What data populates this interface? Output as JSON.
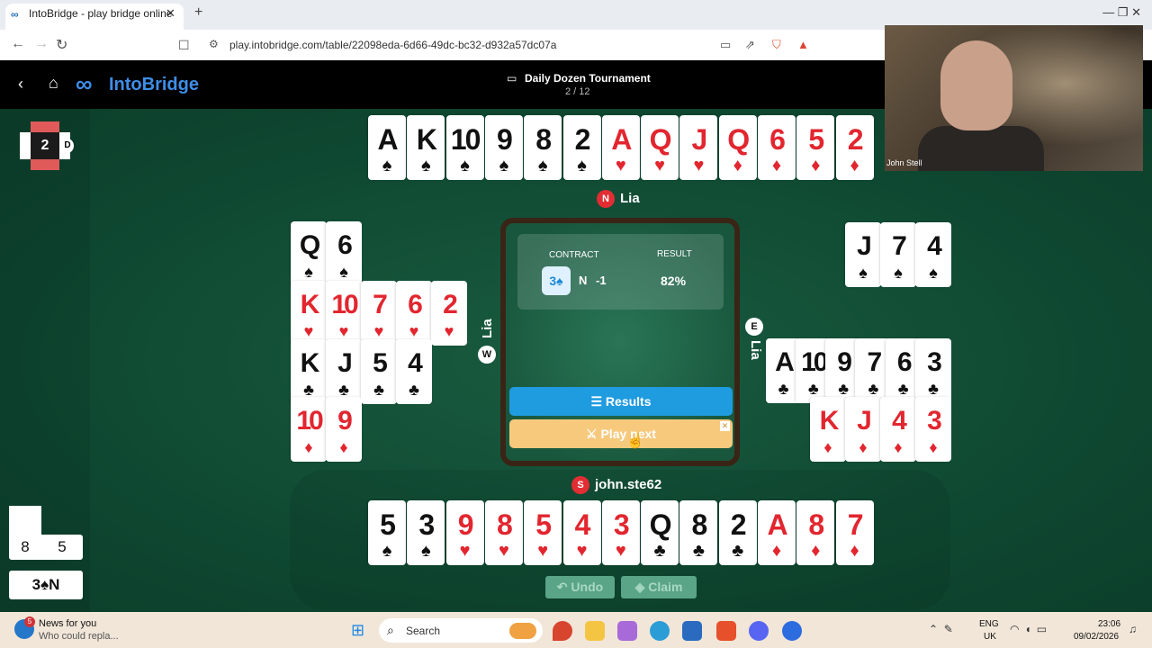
{
  "browser": {
    "tab_title": "IntoBridge - play bridge online",
    "tab_close": "✕",
    "new_tab": "+",
    "url": "play.intobridge.com/table/22098eda-6d66-49dc-bc32-d932a57dc07a",
    "window_controls": "—   ❐   ✕"
  },
  "app": {
    "logo_mark": "∞",
    "logo_text": "IntoBridge",
    "back": "‹",
    "home": "⌂",
    "tournament_title": "Daily Dozen Tournament",
    "tournament_icon": "▭",
    "board_progress": "2 / 12"
  },
  "board": {
    "number": "2",
    "dealer": "D"
  },
  "north": {
    "seat": "N",
    "name": "Lia",
    "cards": [
      {
        "rank": "A",
        "suit": "♠",
        "color": "black"
      },
      {
        "rank": "K",
        "suit": "♠",
        "color": "black"
      },
      {
        "rank": "10",
        "suit": "♠",
        "color": "black"
      },
      {
        "rank": "9",
        "suit": "♠",
        "color": "black"
      },
      {
        "rank": "8",
        "suit": "♠",
        "color": "black"
      },
      {
        "rank": "2",
        "suit": "♠",
        "color": "black"
      },
      {
        "rank": "A",
        "suit": "♥",
        "color": "red"
      },
      {
        "rank": "Q",
        "suit": "♥",
        "color": "red"
      },
      {
        "rank": "J",
        "suit": "♥",
        "color": "red"
      },
      {
        "rank": "Q",
        "suit": "♦",
        "color": "red"
      },
      {
        "rank": "6",
        "suit": "♦",
        "color": "red"
      },
      {
        "rank": "5",
        "suit": "♦",
        "color": "red"
      },
      {
        "rank": "2",
        "suit": "♦",
        "color": "red"
      }
    ]
  },
  "south": {
    "seat": "S",
    "name": "john.ste62",
    "cards": [
      {
        "rank": "5",
        "suit": "♠",
        "color": "black"
      },
      {
        "rank": "3",
        "suit": "♠",
        "color": "black"
      },
      {
        "rank": "9",
        "suit": "♥",
        "color": "red"
      },
      {
        "rank": "8",
        "suit": "♥",
        "color": "red"
      },
      {
        "rank": "5",
        "suit": "♥",
        "color": "red"
      },
      {
        "rank": "4",
        "suit": "♥",
        "color": "red"
      },
      {
        "rank": "3",
        "suit": "♥",
        "color": "red"
      },
      {
        "rank": "Q",
        "suit": "♣",
        "color": "black"
      },
      {
        "rank": "8",
        "suit": "♣",
        "color": "black"
      },
      {
        "rank": "2",
        "suit": "♣",
        "color": "black"
      },
      {
        "rank": "A",
        "suit": "♦",
        "color": "red"
      },
      {
        "rank": "8",
        "suit": "♦",
        "color": "red"
      },
      {
        "rank": "7",
        "suit": "♦",
        "color": "red"
      }
    ]
  },
  "west": {
    "seat": "W",
    "name": "Lia",
    "rows": [
      [
        {
          "rank": "Q",
          "suit": "♠",
          "color": "black"
        },
        {
          "rank": "6",
          "suit": "♠",
          "color": "black"
        }
      ],
      [
        {
          "rank": "K",
          "suit": "♥",
          "color": "red"
        },
        {
          "rank": "10",
          "suit": "♥",
          "color": "red"
        },
        {
          "rank": "7",
          "suit": "♥",
          "color": "red"
        },
        {
          "rank": "6",
          "suit": "♥",
          "color": "red"
        },
        {
          "rank": "2",
          "suit": "♥",
          "color": "red"
        }
      ],
      [
        {
          "rank": "K",
          "suit": "♣",
          "color": "black"
        },
        {
          "rank": "J",
          "suit": "♣",
          "color": "black"
        },
        {
          "rank": "5",
          "suit": "♣",
          "color": "black"
        },
        {
          "rank": "4",
          "suit": "♣",
          "color": "black"
        }
      ],
      [
        {
          "rank": "10",
          "suit": "♦",
          "color": "red"
        },
        {
          "rank": "9",
          "suit": "♦",
          "color": "red"
        }
      ]
    ]
  },
  "east": {
    "seat": "E",
    "name": "Lia",
    "rows": [
      [
        {
          "rank": "J",
          "suit": "♠",
          "color": "black"
        },
        {
          "rank": "7",
          "suit": "♠",
          "color": "black"
        },
        {
          "rank": "4",
          "suit": "♠",
          "color": "black"
        }
      ],
      [],
      [
        {
          "rank": "A",
          "suit": "♣",
          "color": "black"
        },
        {
          "rank": "10",
          "suit": "♣",
          "color": "black"
        },
        {
          "rank": "9",
          "suit": "♣",
          "color": "black"
        },
        {
          "rank": "7",
          "suit": "♣",
          "color": "black"
        },
        {
          "rank": "6",
          "suit": "♣",
          "color": "black"
        },
        {
          "rank": "3",
          "suit": "♣",
          "color": "black"
        }
      ],
      [
        {
          "rank": "K",
          "suit": "♦",
          "color": "red"
        },
        {
          "rank": "J",
          "suit": "♦",
          "color": "red"
        },
        {
          "rank": "4",
          "suit": "♦",
          "color": "red"
        },
        {
          "rank": "3",
          "suit": "♦",
          "color": "red"
        }
      ]
    ]
  },
  "result_panel": {
    "contract_label": "CONTRACT",
    "result_label": "RESULT",
    "contract": "3♠",
    "declarer": "N",
    "result": "-1",
    "percent": "82%",
    "results_button": "☰  Results",
    "play_next_button": "⚔  Play next"
  },
  "controls": {
    "undo": "↶ Undo",
    "claim": "◈ Claim"
  },
  "tricks": {
    "ns": "8",
    "ew": "5",
    "contract": "3♠N"
  },
  "video": {
    "name": "John Stell"
  },
  "taskbar": {
    "news_badge": "5",
    "news_title": "News for you",
    "news_sub": "Who could repla...",
    "search": "Search",
    "lang1": "ENG",
    "lang2": "UK",
    "time": "23:06",
    "date": "09/02/2026"
  },
  "colors": {
    "table_green": "#0f4a33",
    "accent_blue": "#1f9be0",
    "play_next": "#f6c97d",
    "seat_red": "#e12d33"
  }
}
